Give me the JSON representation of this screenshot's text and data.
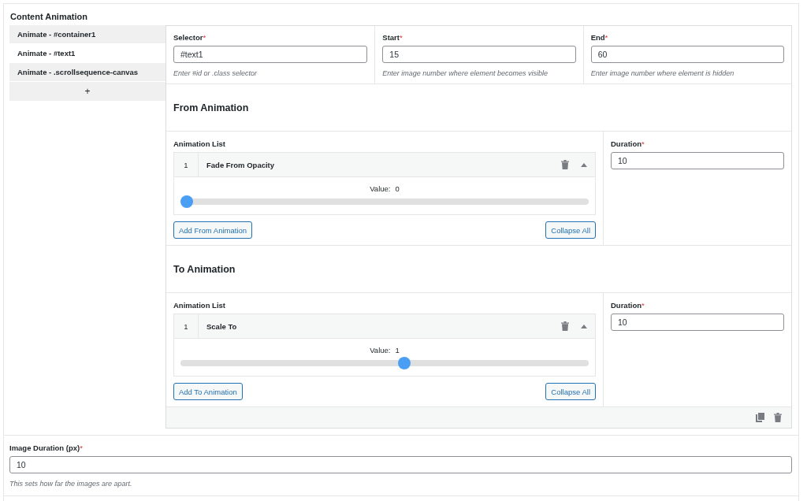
{
  "section_title": "Content Animation",
  "sidebar": {
    "items": [
      {
        "label": "Animate - #container1",
        "selected": false
      },
      {
        "label": "Animate - #text1",
        "selected": true
      },
      {
        "label": "Animate - .scrollsequence-canvas",
        "selected": false
      }
    ],
    "add_button": "+"
  },
  "fields": [
    {
      "label": "Selector",
      "required_mark": "*",
      "value": "#text1",
      "hint": "Enter #id or .class selector"
    },
    {
      "label": "Start",
      "required_mark": "*",
      "value": "15",
      "hint": "Enter image number where element becomes visible"
    },
    {
      "label": "End",
      "required_mark": "*",
      "value": "60",
      "hint": "Enter image number where element is hidden"
    }
  ],
  "animation_groups": [
    {
      "title": "From Animation",
      "list_label": "Animation List",
      "items": [
        {
          "index": "1",
          "name": "Fade From Opacity",
          "expanded": true,
          "value_label": "Value:",
          "value": "0",
          "level": 0
        }
      ],
      "add_button": "Add From Animation",
      "collapse_button": "Collapse All",
      "duration": {
        "label": "Duration",
        "required_mark": "*",
        "value": "10"
      }
    },
    {
      "title": "To Animation",
      "list_label": "Animation List",
      "items": [
        {
          "index": "1",
          "name": "Scale To",
          "expanded": true,
          "value_label": "Value:",
          "value": "1",
          "level": 0.55
        }
      ],
      "add_button": "Add To Animation",
      "collapse_button": "Collapse All",
      "duration": {
        "label": "Duration",
        "required_mark": "*",
        "value": "10"
      }
    }
  ],
  "image_duration": {
    "label": "Image Duration (px)",
    "required_mark": "*",
    "value": "10",
    "hint": "This sets how far the images are apart."
  }
}
